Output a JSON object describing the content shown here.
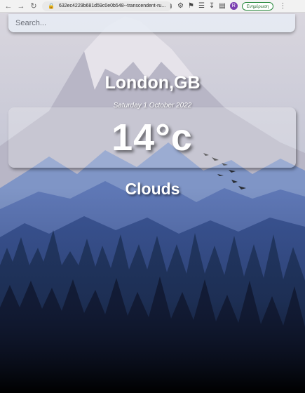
{
  "browser": {
    "url": "632ec4229b681d59c0e0b548--transcendent-ru...",
    "profile_initial": "R",
    "update_label": "Ενημέρωση",
    "back_icon": "arrow-left-icon",
    "forward_icon": "arrow-right-icon",
    "reload_icon": "reload-icon"
  },
  "search": {
    "placeholder": "Search..."
  },
  "weather": {
    "location": "London,GB",
    "date": "Saturday 1 October 2022",
    "temperature": "14°c",
    "condition": "Clouds"
  }
}
